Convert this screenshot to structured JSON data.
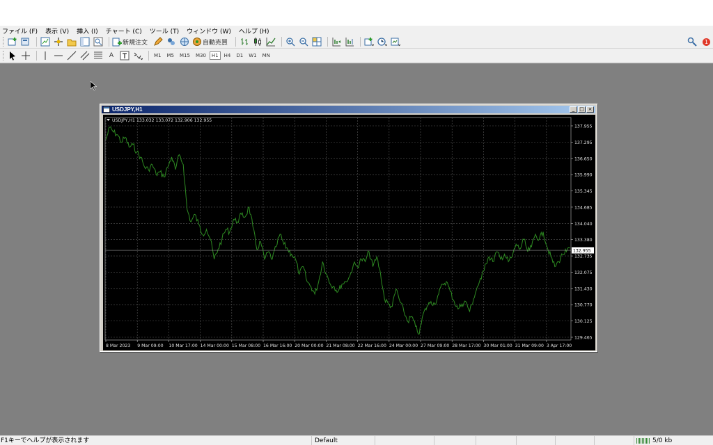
{
  "menu": [
    "ファイル (F)",
    "表示 (V)",
    "挿入 (I)",
    "チャート (C)",
    "ツール (T)",
    "ウィンドウ (W)",
    "ヘルプ (H)"
  ],
  "toolbar": {
    "new_order_label": "新規注文",
    "auto_trading_label": "自動売買",
    "notification_count": "1",
    "timeframes": [
      "M1",
      "M5",
      "M15",
      "M30",
      "H1",
      "H4",
      "D1",
      "W1",
      "MN"
    ],
    "active_timeframe": "H1",
    "text_tool_label": "A"
  },
  "chart_window": {
    "title": "USDJPY,H1",
    "info_line": "USDJPY,H1  133.032 133.072 132.906 132.955",
    "current_price": "132.955"
  },
  "chart_data": {
    "type": "line",
    "title": "USDJPY,H1",
    "background": "#000000",
    "line_color": "#2e8b22",
    "grid": true,
    "grid_style": "dotted",
    "y_ticks": [
      "137.955",
      "137.295",
      "136.650",
      "135.990",
      "135.345",
      "134.685",
      "134.040",
      "133.380",
      "132.735",
      "132.075",
      "131.430",
      "130.770",
      "130.125",
      "129.465"
    ],
    "ylim": [
      129.465,
      137.955
    ],
    "x_ticks": [
      "8 Mar 2023",
      "9 Mar 09:00",
      "10 Mar 17:00",
      "14 Mar 00:00",
      "15 Mar 08:00",
      "16 Mar 16:00",
      "20 Mar 00:00",
      "21 Mar 08:00",
      "22 Mar 16:00",
      "24 Mar 00:00",
      "27 Mar 09:00",
      "28 Mar 17:00",
      "30 Mar 01:00",
      "31 Mar 09:00",
      "3 Apr 17:00"
    ],
    "series": [
      {
        "values": [
          137.4,
          137.9,
          137.7,
          137.6,
          137.3,
          137.5,
          137.1,
          137.2,
          136.9,
          136.7,
          136.3,
          136.2,
          136.4,
          136.0,
          136.1,
          135.9,
          136.3,
          136.7,
          136.2,
          136.8,
          136.4,
          134.6,
          134.1,
          134.4,
          134.0,
          133.6,
          133.8,
          133.4,
          132.6,
          133.0,
          133.4,
          133.8,
          133.7,
          134.2,
          134.1,
          134.4,
          134.3,
          134.7,
          133.9,
          133.0,
          133.3,
          132.6,
          132.9,
          132.6,
          133.1,
          133.6,
          133.2,
          133.0,
          132.8,
          132.6,
          132.0,
          132.3,
          131.7,
          131.5,
          131.2,
          131.7,
          132.5,
          132.0,
          131.6,
          131.5,
          131.3,
          131.6,
          131.7,
          131.9,
          132.4,
          132.3,
          132.6,
          132.5,
          132.9,
          132.3,
          132.7,
          132.0,
          131.0,
          130.8,
          130.7,
          131.4,
          130.9,
          130.5,
          130.1,
          130.3,
          129.9,
          129.6,
          130.4,
          130.7,
          130.9,
          130.8,
          131.2,
          131.6,
          131.7,
          131.3,
          130.9,
          130.6,
          130.8,
          130.9,
          130.5,
          131.0,
          131.5,
          131.8,
          132.4,
          132.7,
          132.5,
          132.9,
          132.6,
          132.8,
          132.5,
          132.7,
          133.2,
          133.0,
          133.4,
          132.9,
          133.1,
          133.6,
          133.4,
          133.7,
          133.1,
          132.7,
          132.3,
          132.5,
          132.8,
          132.9,
          133.05
        ]
      }
    ]
  },
  "statusbar": {
    "help_text": "F1キーでヘルプが表示されます",
    "profile": "Default",
    "traffic": "5/0 kb"
  }
}
